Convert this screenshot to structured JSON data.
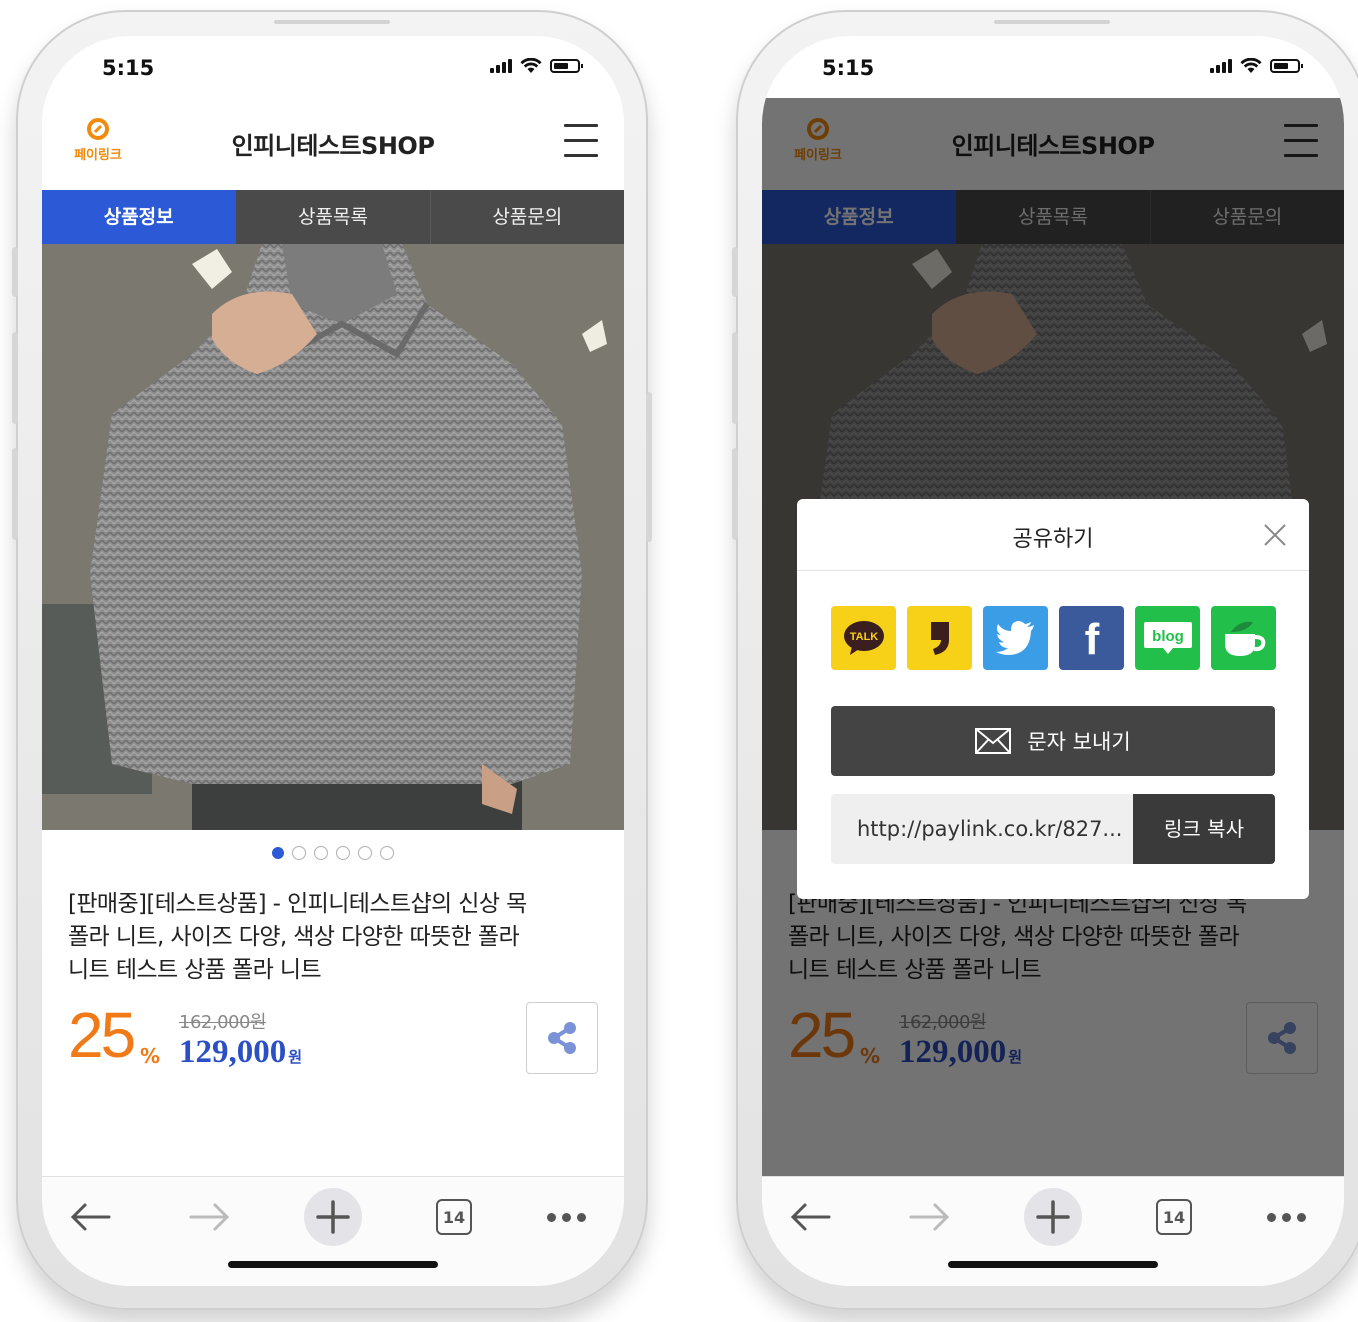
{
  "status": {
    "time": "5:15"
  },
  "header": {
    "logo_text": "페이링크",
    "title": "인피니테스트SHOP"
  },
  "tabs": [
    {
      "label": "상품정보",
      "active": true
    },
    {
      "label": "상품목록",
      "active": false
    },
    {
      "label": "상품문의",
      "active": false
    }
  ],
  "gallery": {
    "total": 6,
    "current": 1
  },
  "product": {
    "name_lines": [
      "[판매중][테스트상품] - 인피니테스트샵의 신상 목",
      "폴라 니트, 사이즈 다양, 색상 다양한 따뜻한 폴라",
      "니트 테스트 상품 폴라 니트"
    ],
    "discount": "25",
    "discount_unit": "%",
    "original_price": "162,000원",
    "price": "129,000",
    "price_unit": "원"
  },
  "browser_bar": {
    "tab_count": "14"
  },
  "share_modal": {
    "title": "공유하기",
    "sns": [
      {
        "name": "kakaotalk",
        "label": "TALK",
        "color": "#f7d117"
      },
      {
        "name": "kakaostory",
        "label": "",
        "color": "#f7d117"
      },
      {
        "name": "twitter",
        "label": "",
        "color": "#3b9de6"
      },
      {
        "name": "facebook",
        "label": "f",
        "color": "#3b5a9c"
      },
      {
        "name": "naver-blog",
        "label": "blog",
        "color": "#22c04a"
      },
      {
        "name": "naver-cafe",
        "label": "",
        "color": "#22c04a"
      }
    ],
    "sms_label": "문자 보내기",
    "link_url": "http://paylink.co.kr/827...",
    "copy_label": "링크 복사"
  },
  "colors": {
    "accent": "#2c5ad6",
    "discount": "#f07a18",
    "price": "#2b4fc4",
    "tab_bar": "#4a4a4a"
  }
}
